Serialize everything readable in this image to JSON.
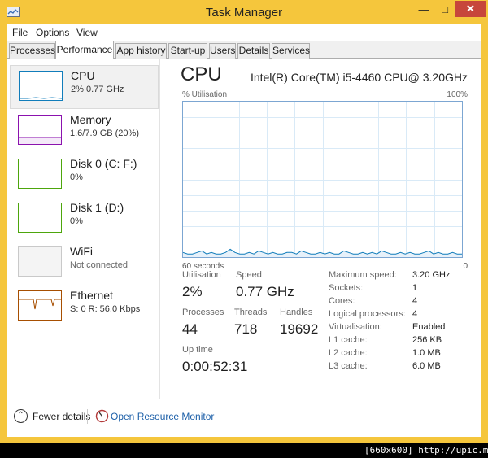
{
  "window": {
    "title": "Task Manager"
  },
  "menu": {
    "file": "File",
    "options": "Options",
    "view": "View"
  },
  "tabs": [
    "Processes",
    "Performance",
    "App history",
    "Start-up",
    "Users",
    "Details",
    "Services"
  ],
  "active_tab": "Performance",
  "sidebar": [
    {
      "name": "CPU",
      "detail": "2% 0.77 GHz",
      "color": "#117dbb"
    },
    {
      "name": "Memory",
      "detail": "1.6/7.9 GB (20%)",
      "color": "#8b12ae"
    },
    {
      "name": "Disk 0 (C: F:)",
      "detail": "0%",
      "color": "#4da60c"
    },
    {
      "name": "Disk 1 (D:)",
      "detail": "0%",
      "color": "#4da60c"
    },
    {
      "name": "WiFi",
      "detail": "Not connected",
      "color": "#c9c9c9"
    },
    {
      "name": "Ethernet",
      "detail": "S: 0 R: 56.0 Kbps",
      "color": "#a74f01"
    }
  ],
  "main": {
    "title": "CPU",
    "model": "Intel(R) Core(TM) i5-4460 CPU@ 3.20GHz",
    "util_label": "% Utilisation",
    "util_max": "100%",
    "time_left": "60 seconds",
    "time_right": "0"
  },
  "stats": {
    "utilisation_label": "Utilisation",
    "utilisation": "2%",
    "speed_label": "Speed",
    "speed": "0.77 GHz",
    "processes_label": "Processes",
    "processes": "44",
    "threads_label": "Threads",
    "threads": "718",
    "handles_label": "Handles",
    "handles": "19692",
    "uptime_label": "Up time",
    "uptime": "0:00:52:31"
  },
  "details": [
    {
      "key": "Maximum speed:",
      "value": "3.20 GHz"
    },
    {
      "key": "Sockets:",
      "value": "1"
    },
    {
      "key": "Cores:",
      "value": "4"
    },
    {
      "key": "Logical processors:",
      "value": "4"
    },
    {
      "key": "Virtualisation:",
      "value": "Enabled"
    },
    {
      "key": "L1 cache:",
      "value": "256 KB"
    },
    {
      "key": "L2 cache:",
      "value": "1.0 MB"
    },
    {
      "key": "L3 cache:",
      "value": "6.0 MB"
    }
  ],
  "footer": {
    "fewer_details": "Fewer details",
    "open_monitor": "Open Resource Monitor"
  },
  "watermark": "[660x600] http://upic.me/",
  "cpu_history": [
    3,
    2,
    2,
    3,
    4,
    2,
    3,
    2,
    2,
    3,
    5,
    3,
    2,
    2,
    3,
    2,
    4,
    3,
    2,
    3,
    2,
    2,
    3,
    3,
    2,
    4,
    3,
    2,
    2,
    3,
    2,
    3,
    2,
    2,
    4,
    3,
    2,
    2,
    3,
    2,
    3,
    2,
    4,
    3,
    2,
    2,
    3,
    2,
    3,
    2,
    2,
    3,
    4,
    2,
    3,
    2,
    2,
    3,
    2,
    2
  ]
}
